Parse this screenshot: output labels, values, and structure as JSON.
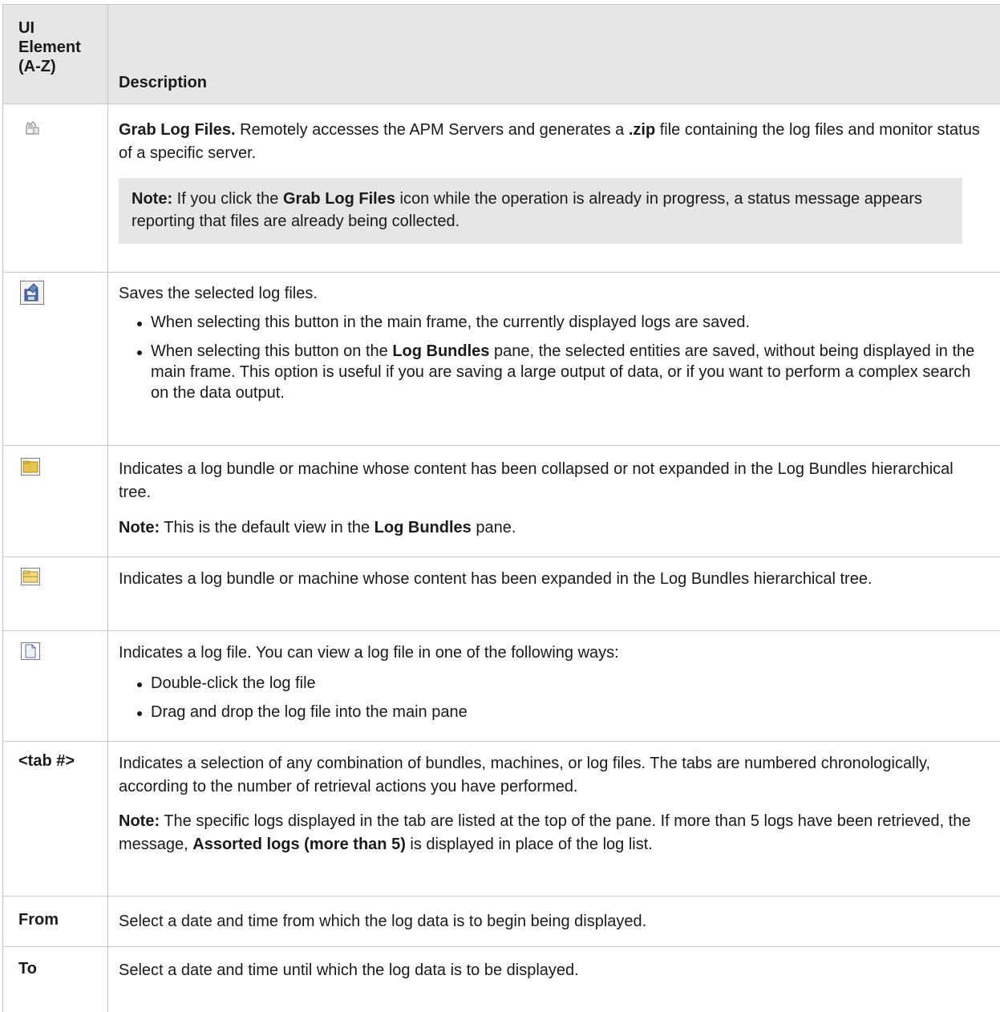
{
  "header": {
    "col1": [
      "UI",
      "Element",
      "(A-Z)"
    ],
    "col2": "Description"
  },
  "rows": [
    {
      "icon": "grab-log-files-icon",
      "bold": "Grab Log Files.",
      "text1": " Remotely accesses the APM Servers and generates a ",
      "bold2": ".zip",
      "text2": " file containing the log files and monitor status of a specific server.",
      "note_bold": "Note:",
      "note_text1": " If you click the ",
      "note_bold2": "Grab Log Files",
      "note_text2": " icon while the operation is already in progress, a status message appears reporting that files are already being collected."
    },
    {
      "icon": "save-icon",
      "text": "Saves the selected log files.",
      "bullet1": "When selecting this button in the main frame, the currently displayed logs are saved.",
      "bullet2_a": "When selecting this button on the ",
      "bullet2_bold": "Log Bundles",
      "bullet2_b": " pane, the selected entities are saved, without being displayed in the main frame. This option is useful if you are saving a large output of data, or if you want to perform a complex search on the data output."
    },
    {
      "icon": "folder-closed-icon",
      "text": "Indicates a log bundle or machine whose content has been collapsed or not expanded in the Log Bundles hierarchical tree.",
      "note_bold": "Note:",
      "note_text1": " This is the default view in the ",
      "note_bold2": "Log Bundles",
      "note_text2": " pane."
    },
    {
      "icon": "folder-open-icon",
      "text": "Indicates a log bundle or machine whose content has been expanded in the Log Bundles hierarchical tree."
    },
    {
      "icon": "log-file-icon",
      "text": "Indicates a log file. You can view a log file in one of the following ways:",
      "bullet1": "Double-click the log file",
      "bullet2": "Drag and drop the log file into the main pane"
    },
    {
      "label": "<tab #>",
      "text": "Indicates a selection of any combination of bundles, machines, or log files. The tabs are numbered chronologically, according to the number of retrieval actions you have performed.",
      "note_bold": "Note:",
      "note_text1": " The specific logs displayed in the tab are listed at the top of the pane. If more than 5 logs have been retrieved, the message, ",
      "note_bold2": "Assorted logs (more than 5)",
      "note_text2": " is displayed in place of the log list."
    },
    {
      "label": "From",
      "text": "Select a date and time from which the log data is to begin being displayed."
    },
    {
      "label": "To",
      "text": "Select a date and time until which the log data is to be displayed."
    }
  ]
}
